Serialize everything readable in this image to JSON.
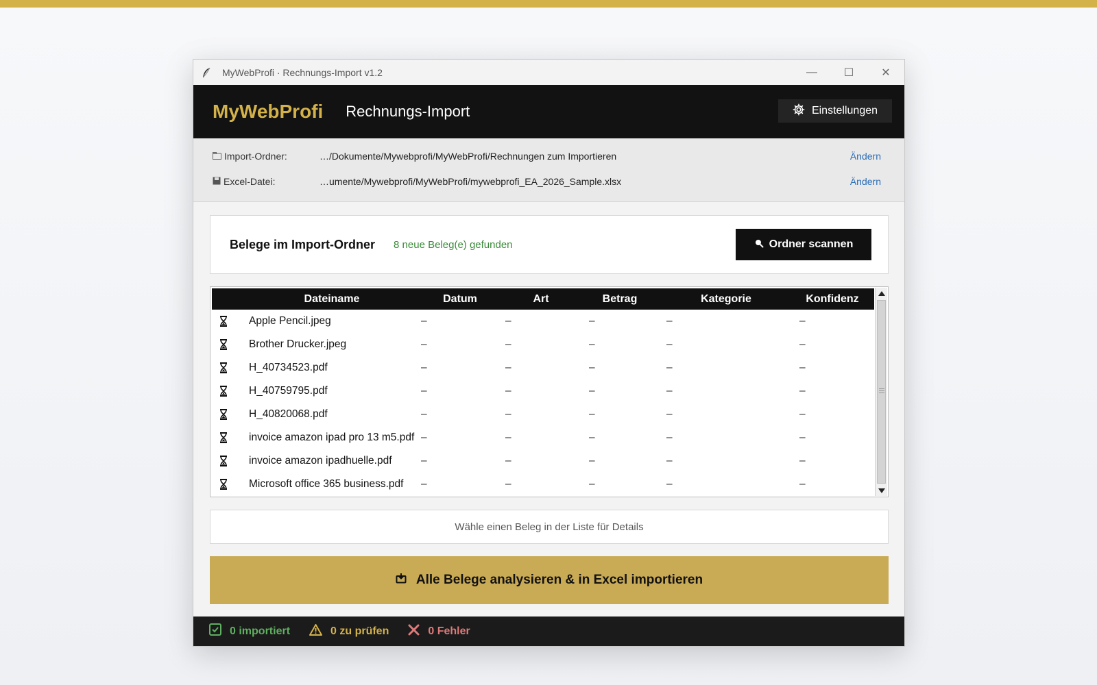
{
  "window": {
    "title": "MyWebProfi · Rechnungs-Import v1.2",
    "controls": {
      "minimize": "—",
      "maximize": "☐",
      "close": "✕"
    }
  },
  "header": {
    "brand": "MyWebProfi",
    "subtitle": "Rechnungs-Import",
    "settings_label": "Einstellungen"
  },
  "paths": {
    "import_label": "Import-Ordner:",
    "import_value": "…/Dokumente/Mywebprofi/MyWebProfi/Rechnungen zum Importieren",
    "excel_label": "Excel-Datei:",
    "excel_value": "…umente/Mywebprofi/MyWebProfi/mywebprofi_EA_2026_Sample.xlsx",
    "change_label": "Ändern"
  },
  "scan": {
    "title": "Belege im Import-Ordner",
    "status": "8 neue Beleg(e) gefunden",
    "button_label": "Ordner scannen"
  },
  "table": {
    "columns": [
      "Dateiname",
      "Datum",
      "Art",
      "Betrag",
      "Kategorie",
      "Konfidenz"
    ],
    "rows": [
      {
        "file": "Apple Pencil.jpeg",
        "datum": "–",
        "art": "–",
        "betrag": "–",
        "kategorie": "–",
        "konfidenz": "–"
      },
      {
        "file": "Brother Drucker.jpeg",
        "datum": "–",
        "art": "–",
        "betrag": "–",
        "kategorie": "–",
        "konfidenz": "–"
      },
      {
        "file": "H_40734523.pdf",
        "datum": "–",
        "art": "–",
        "betrag": "–",
        "kategorie": "–",
        "konfidenz": "–"
      },
      {
        "file": "H_40759795.pdf",
        "datum": "–",
        "art": "–",
        "betrag": "–",
        "kategorie": "–",
        "konfidenz": "–"
      },
      {
        "file": "H_40820068.pdf",
        "datum": "–",
        "art": "–",
        "betrag": "–",
        "kategorie": "–",
        "konfidenz": "–"
      },
      {
        "file": "invoice amazon ipad pro 13 m5.pdf",
        "datum": "–",
        "art": "–",
        "betrag": "–",
        "kategorie": "–",
        "konfidenz": "–"
      },
      {
        "file": "invoice amazon ipadhuelle.pdf",
        "datum": "–",
        "art": "–",
        "betrag": "–",
        "kategorie": "–",
        "konfidenz": "–"
      },
      {
        "file": "Microsoft office 365 business.pdf",
        "datum": "–",
        "art": "–",
        "betrag": "–",
        "kategorie": "–",
        "konfidenz": "–"
      }
    ]
  },
  "details": {
    "placeholder": "Wähle einen Beleg in der Liste für Details"
  },
  "import_button": {
    "label": "Alle Belege analysieren & in Excel importieren"
  },
  "status": {
    "imported": "0 importiert",
    "to_check": "0 zu prüfen",
    "errors": "0 Fehler"
  },
  "colors": {
    "accent_gold": "#d4b24a",
    "import_button": "#c9aa55",
    "header_bg": "#121212",
    "ok_green": "#5fb060",
    "error_red": "#e07a7a",
    "link_blue": "#2a6db5"
  }
}
